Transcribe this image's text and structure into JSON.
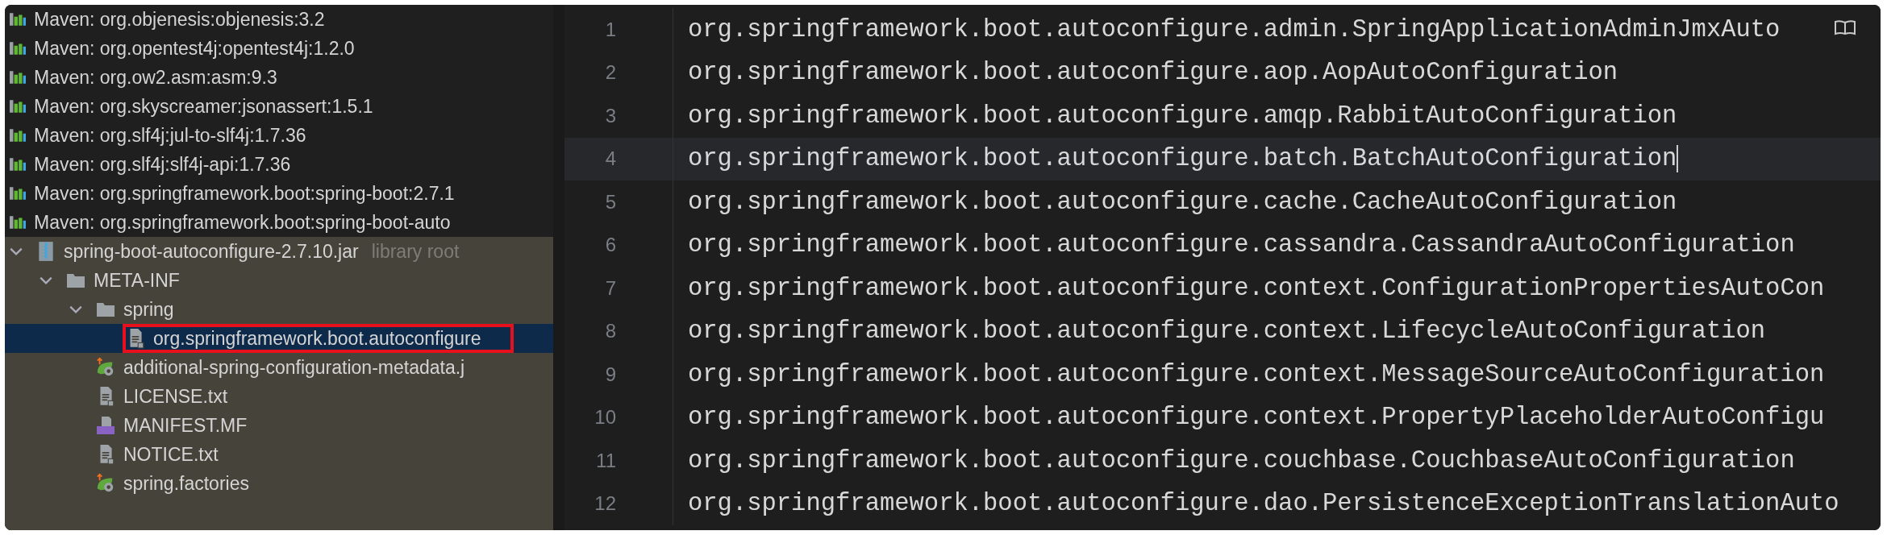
{
  "project_tree": {
    "libraries": [
      {
        "label": "Maven: org.objenesis:objenesis:3.2"
      },
      {
        "label": "Maven: org.opentest4j:opentest4j:1.2.0"
      },
      {
        "label": "Maven: org.ow2.asm:asm:9.3"
      },
      {
        "label": "Maven: org.skyscreamer:jsonassert:1.5.1"
      },
      {
        "label": "Maven: org.slf4j:jul-to-slf4j:1.7.36"
      },
      {
        "label": "Maven: org.slf4j:slf4j-api:1.7.36"
      },
      {
        "label": "Maven: org.springframework.boot:spring-boot:2.7.1"
      },
      {
        "label": "Maven: org.springframework.boot:spring-boot-auto"
      }
    ],
    "nodes": [
      {
        "label": "spring-boot-autoconfigure-2.7.10.jar",
        "hint": "library root",
        "kind": "jar",
        "expanded": true,
        "selected": false,
        "children": [
          {
            "label": "META-INF",
            "kind": "folder",
            "expanded": true,
            "selected": false,
            "children": [
              {
                "label": "spring",
                "kind": "folder",
                "expanded": true,
                "selected": false,
                "children": [
                  {
                    "label": "org.springframework.boot.autoconfigure",
                    "kind": "text-file",
                    "selected": true,
                    "outlined": true
                  }
                ]
              },
              {
                "label": "additional-spring-configuration-metadata.j",
                "kind": "spring-config",
                "selected": false
              },
              {
                "label": "LICENSE.txt",
                "kind": "text-file",
                "selected": false
              },
              {
                "label": "MANIFEST.MF",
                "kind": "manifest",
                "selected": false
              },
              {
                "label": "NOTICE.txt",
                "kind": "text-file",
                "selected": false
              },
              {
                "label": "spring.factories",
                "kind": "spring-config",
                "selected": false
              }
            ]
          }
        ]
      }
    ]
  },
  "editor": {
    "lines": [
      {
        "number": "1",
        "text": "org.springframework.boot.autoconfigure.admin.SpringApplicationAdminJmxAuto",
        "current": false
      },
      {
        "number": "2",
        "text": "org.springframework.boot.autoconfigure.aop.AopAutoConfiguration",
        "current": false
      },
      {
        "number": "3",
        "text": "org.springframework.boot.autoconfigure.amqp.RabbitAutoConfiguration",
        "current": false
      },
      {
        "number": "4",
        "text": "org.springframework.boot.autoconfigure.batch.BatchAutoConfiguration",
        "current": true
      },
      {
        "number": "5",
        "text": "org.springframework.boot.autoconfigure.cache.CacheAutoConfiguration",
        "current": false
      },
      {
        "number": "6",
        "text": "org.springframework.boot.autoconfigure.cassandra.CassandraAutoConfiguration",
        "current": false
      },
      {
        "number": "7",
        "text": "org.springframework.boot.autoconfigure.context.ConfigurationPropertiesAutoCon",
        "current": false
      },
      {
        "number": "8",
        "text": "org.springframework.boot.autoconfigure.context.LifecycleAutoConfiguration",
        "current": false
      },
      {
        "number": "9",
        "text": "org.springframework.boot.autoconfigure.context.MessageSourceAutoConfiguration",
        "current": false
      },
      {
        "number": "10",
        "text": "org.springframework.boot.autoconfigure.context.PropertyPlaceholderAutoConfigu",
        "current": false
      },
      {
        "number": "11",
        "text": "org.springframework.boot.autoconfigure.couchbase.CouchbaseAutoConfiguration",
        "current": false
      },
      {
        "number": "12",
        "text": "org.springframework.boot.autoconfigure.dao.PersistenceExceptionTranslationAuto",
        "current": false
      }
    ]
  }
}
